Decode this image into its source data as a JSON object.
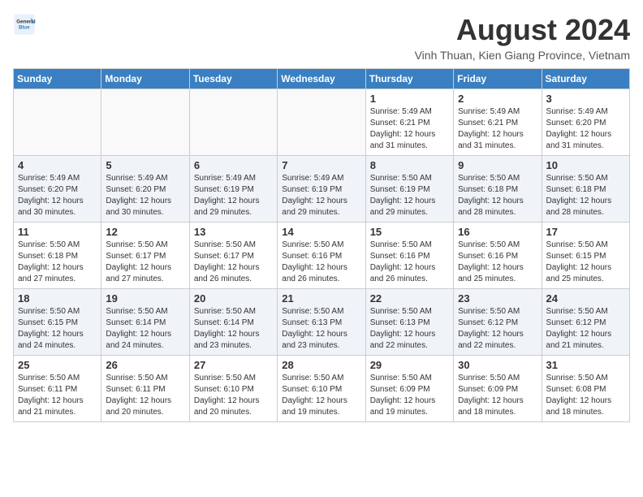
{
  "header": {
    "logo_general": "General",
    "logo_blue": "Blue",
    "month_year": "August 2024",
    "location": "Vinh Thuan, Kien Giang Province, Vietnam"
  },
  "columns": [
    "Sunday",
    "Monday",
    "Tuesday",
    "Wednesday",
    "Thursday",
    "Friday",
    "Saturday"
  ],
  "weeks": [
    [
      {
        "day": "",
        "info": ""
      },
      {
        "day": "",
        "info": ""
      },
      {
        "day": "",
        "info": ""
      },
      {
        "day": "",
        "info": ""
      },
      {
        "day": "1",
        "info": "Sunrise: 5:49 AM\nSunset: 6:21 PM\nDaylight: 12 hours\nand 31 minutes."
      },
      {
        "day": "2",
        "info": "Sunrise: 5:49 AM\nSunset: 6:21 PM\nDaylight: 12 hours\nand 31 minutes."
      },
      {
        "day": "3",
        "info": "Sunrise: 5:49 AM\nSunset: 6:20 PM\nDaylight: 12 hours\nand 31 minutes."
      }
    ],
    [
      {
        "day": "4",
        "info": "Sunrise: 5:49 AM\nSunset: 6:20 PM\nDaylight: 12 hours\nand 30 minutes."
      },
      {
        "day": "5",
        "info": "Sunrise: 5:49 AM\nSunset: 6:20 PM\nDaylight: 12 hours\nand 30 minutes."
      },
      {
        "day": "6",
        "info": "Sunrise: 5:49 AM\nSunset: 6:19 PM\nDaylight: 12 hours\nand 29 minutes."
      },
      {
        "day": "7",
        "info": "Sunrise: 5:49 AM\nSunset: 6:19 PM\nDaylight: 12 hours\nand 29 minutes."
      },
      {
        "day": "8",
        "info": "Sunrise: 5:50 AM\nSunset: 6:19 PM\nDaylight: 12 hours\nand 29 minutes."
      },
      {
        "day": "9",
        "info": "Sunrise: 5:50 AM\nSunset: 6:18 PM\nDaylight: 12 hours\nand 28 minutes."
      },
      {
        "day": "10",
        "info": "Sunrise: 5:50 AM\nSunset: 6:18 PM\nDaylight: 12 hours\nand 28 minutes."
      }
    ],
    [
      {
        "day": "11",
        "info": "Sunrise: 5:50 AM\nSunset: 6:18 PM\nDaylight: 12 hours\nand 27 minutes."
      },
      {
        "day": "12",
        "info": "Sunrise: 5:50 AM\nSunset: 6:17 PM\nDaylight: 12 hours\nand 27 minutes."
      },
      {
        "day": "13",
        "info": "Sunrise: 5:50 AM\nSunset: 6:17 PM\nDaylight: 12 hours\nand 26 minutes."
      },
      {
        "day": "14",
        "info": "Sunrise: 5:50 AM\nSunset: 6:16 PM\nDaylight: 12 hours\nand 26 minutes."
      },
      {
        "day": "15",
        "info": "Sunrise: 5:50 AM\nSunset: 6:16 PM\nDaylight: 12 hours\nand 26 minutes."
      },
      {
        "day": "16",
        "info": "Sunrise: 5:50 AM\nSunset: 6:16 PM\nDaylight: 12 hours\nand 25 minutes."
      },
      {
        "day": "17",
        "info": "Sunrise: 5:50 AM\nSunset: 6:15 PM\nDaylight: 12 hours\nand 25 minutes."
      }
    ],
    [
      {
        "day": "18",
        "info": "Sunrise: 5:50 AM\nSunset: 6:15 PM\nDaylight: 12 hours\nand 24 minutes."
      },
      {
        "day": "19",
        "info": "Sunrise: 5:50 AM\nSunset: 6:14 PM\nDaylight: 12 hours\nand 24 minutes."
      },
      {
        "day": "20",
        "info": "Sunrise: 5:50 AM\nSunset: 6:14 PM\nDaylight: 12 hours\nand 23 minutes."
      },
      {
        "day": "21",
        "info": "Sunrise: 5:50 AM\nSunset: 6:13 PM\nDaylight: 12 hours\nand 23 minutes."
      },
      {
        "day": "22",
        "info": "Sunrise: 5:50 AM\nSunset: 6:13 PM\nDaylight: 12 hours\nand 22 minutes."
      },
      {
        "day": "23",
        "info": "Sunrise: 5:50 AM\nSunset: 6:12 PM\nDaylight: 12 hours\nand 22 minutes."
      },
      {
        "day": "24",
        "info": "Sunrise: 5:50 AM\nSunset: 6:12 PM\nDaylight: 12 hours\nand 21 minutes."
      }
    ],
    [
      {
        "day": "25",
        "info": "Sunrise: 5:50 AM\nSunset: 6:11 PM\nDaylight: 12 hours\nand 21 minutes."
      },
      {
        "day": "26",
        "info": "Sunrise: 5:50 AM\nSunset: 6:11 PM\nDaylight: 12 hours\nand 20 minutes."
      },
      {
        "day": "27",
        "info": "Sunrise: 5:50 AM\nSunset: 6:10 PM\nDaylight: 12 hours\nand 20 minutes."
      },
      {
        "day": "28",
        "info": "Sunrise: 5:50 AM\nSunset: 6:10 PM\nDaylight: 12 hours\nand 19 minutes."
      },
      {
        "day": "29",
        "info": "Sunrise: 5:50 AM\nSunset: 6:09 PM\nDaylight: 12 hours\nand 19 minutes."
      },
      {
        "day": "30",
        "info": "Sunrise: 5:50 AM\nSunset: 6:09 PM\nDaylight: 12 hours\nand 18 minutes."
      },
      {
        "day": "31",
        "info": "Sunrise: 5:50 AM\nSunset: 6:08 PM\nDaylight: 12 hours\nand 18 minutes."
      }
    ]
  ]
}
